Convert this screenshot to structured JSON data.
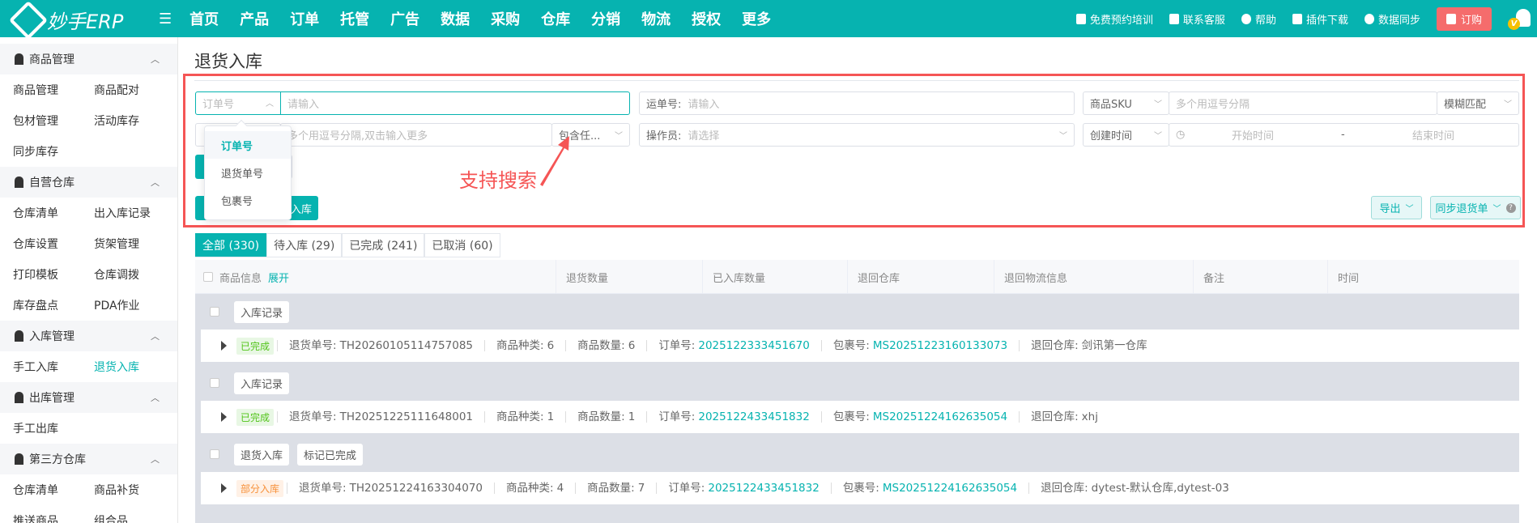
{
  "app": {
    "logo_text": "妙手ERP"
  },
  "nav": {
    "items": [
      {
        "label": "首页",
        "dot": false
      },
      {
        "label": "产品",
        "dot": false
      },
      {
        "label": "订单",
        "dot": true
      },
      {
        "label": "托管",
        "dot": true
      },
      {
        "label": "广告",
        "dot": false
      },
      {
        "label": "数据",
        "dot": false
      },
      {
        "label": "采购",
        "dot": true
      },
      {
        "label": "仓库",
        "dot": true
      },
      {
        "label": "分销",
        "dot": false
      },
      {
        "label": "物流",
        "dot": false
      },
      {
        "label": "授权",
        "dot": false
      },
      {
        "label": "更多",
        "dot": false
      }
    ]
  },
  "header_right": {
    "training": "免费预约培训",
    "service": "联系客服",
    "help": "帮助",
    "plugin": "插件下载",
    "sync": "数据同步",
    "order": "订购",
    "avatar_badge": "V"
  },
  "sidebar": [
    {
      "title": "商品管理",
      "rows": [
        [
          "商品管理",
          "商品配对"
        ],
        [
          "包材管理",
          "活动库存"
        ],
        [
          "同步库存"
        ]
      ]
    },
    {
      "title": "自营仓库",
      "rows": [
        [
          "仓库清单",
          "出入库记录"
        ],
        [
          "仓库设置",
          "货架管理"
        ],
        [
          "打印模板",
          "仓库调拨"
        ],
        [
          "库存盘点",
          "PDA作业"
        ]
      ]
    },
    {
      "title": "入库管理",
      "rows": [
        [
          "手工入库",
          "退货入库"
        ]
      ]
    },
    {
      "title": "出库管理",
      "rows": [
        [
          "手工出库"
        ]
      ]
    },
    {
      "title": "第三方仓库",
      "rows": [
        [
          "仓库清单",
          "商品补货"
        ],
        [
          "推送商品",
          "组合品"
        ]
      ]
    }
  ],
  "active_item": "退货入库",
  "page": {
    "title": "退货入库"
  },
  "filters": {
    "order_select": "订单号",
    "order_placeholder": "请输入",
    "waybill_label": "运单号:",
    "waybill_placeholder": "请输入",
    "sku_select": "商品SKU",
    "sku_placeholder": "多个用逗号分隔",
    "match_select": "模糊匹配",
    "multi_placeholder": "多个用逗号分隔,双击输入更多",
    "contain_select": "包含任...",
    "operator_label": "操作员:",
    "operator_placeholder": "请选择",
    "time_select": "创建时间",
    "start_placeholder": "开始时间",
    "range_sep": "-",
    "end_placeholder": "结束时间"
  },
  "dropdown": {
    "options": [
      "订单号",
      "退货单号",
      "包裹号"
    ],
    "selected": "订单号"
  },
  "buttons": {
    "inbound": "入库",
    "export": "导出",
    "sync_returns": "同步退货单"
  },
  "annotation": "支持搜索",
  "tabs": [
    {
      "label": "全部 (330)",
      "active": true
    },
    {
      "label": "待入库 (29)"
    },
    {
      "label": "已完成 (241)"
    },
    {
      "label": "已取消 (60)"
    }
  ],
  "table": {
    "columns": [
      "商品信息",
      "退货数量",
      "已入库数量",
      "退回仓库",
      "退回物流信息",
      "备注",
      "时间"
    ],
    "expand": "展开"
  },
  "groups": [
    {
      "actions": [
        "入库记录"
      ],
      "status": "已完成",
      "status_type": "done",
      "return_no_label": "退货单号:",
      "return_no": "TH20260105114757085",
      "kinds_label": "商品种类:",
      "kinds": "6",
      "qty_label": "商品数量:",
      "qty": "6",
      "order_label": "订单号:",
      "order_no": "2025122333451670",
      "pkg_label": "包裹号:",
      "pkg_no": "MS20251223160133073",
      "wh_label": "退回仓库:",
      "wh": "剑讯第一仓库"
    },
    {
      "actions": [
        "入库记录"
      ],
      "status": "已完成",
      "status_type": "done",
      "return_no_label": "退货单号:",
      "return_no": "TH20251225111648001",
      "kinds_label": "商品种类:",
      "kinds": "1",
      "qty_label": "商品数量:",
      "qty": "1",
      "order_label": "订单号:",
      "order_no": "2025122433451832",
      "pkg_label": "包裹号:",
      "pkg_no": "MS20251224162635054",
      "wh_label": "退回仓库:",
      "wh": "xhj"
    },
    {
      "actions": [
        "退货入库",
        "标记已完成"
      ],
      "status": "部分入库",
      "status_type": "part",
      "return_no_label": "退货单号:",
      "return_no": "TH20251224163304070",
      "kinds_label": "商品种类:",
      "kinds": "4",
      "qty_label": "商品数量:",
      "qty": "7",
      "order_label": "订单号:",
      "order_no": "2025122433451832",
      "pkg_label": "包裹号:",
      "pkg_no": "MS20251224162635054",
      "wh_label": "退回仓库:",
      "wh": "dytest-默认仓库,dytest-03"
    }
  ]
}
